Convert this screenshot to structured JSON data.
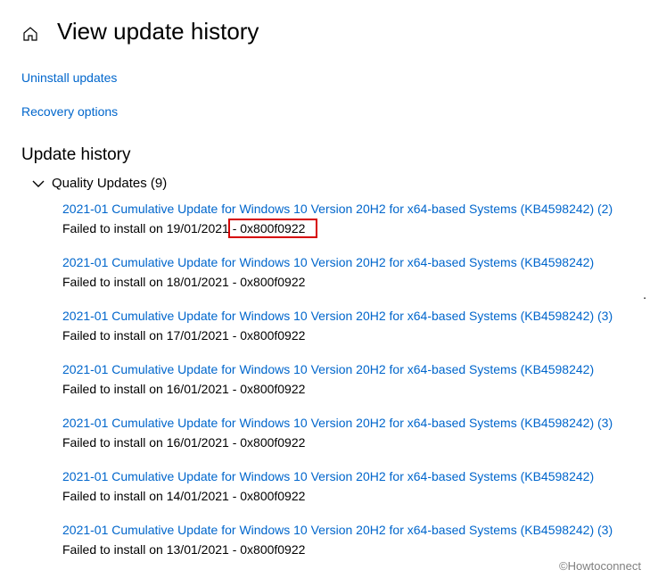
{
  "page_title": "View update history",
  "links": {
    "uninstall": "Uninstall updates",
    "recovery": "Recovery options"
  },
  "section_heading": "Update history",
  "group": {
    "label": "Quality Updates (9)"
  },
  "updates": [
    {
      "title": "2021-01 Cumulative Update for Windows 10 Version 20H2 for x64-based Systems (KB4598242) (2)",
      "status": "Failed to install on 19/01/2021 - 0x800f0922",
      "highlighted": true
    },
    {
      "title": "2021-01 Cumulative Update for Windows 10 Version 20H2 for x64-based Systems (KB4598242)",
      "status": "Failed to install on 18/01/2021 - 0x800f0922"
    },
    {
      "title": "2021-01 Cumulative Update for Windows 10 Version 20H2 for x64-based Systems (KB4598242) (3)",
      "status": "Failed to install on 17/01/2021 - 0x800f0922"
    },
    {
      "title": "2021-01 Cumulative Update for Windows 10 Version 20H2 for x64-based Systems (KB4598242)",
      "status": "Failed to install on 16/01/2021 - 0x800f0922"
    },
    {
      "title": "2021-01 Cumulative Update for Windows 10 Version 20H2 for x64-based Systems (KB4598242) (3)",
      "status": "Failed to install on 16/01/2021 - 0x800f0922"
    },
    {
      "title": "2021-01 Cumulative Update for Windows 10 Version 20H2 for x64-based Systems (KB4598242)",
      "status": "Failed to install on 14/01/2021 - 0x800f0922"
    },
    {
      "title": "2021-01 Cumulative Update for Windows 10 Version 20H2 for x64-based Systems (KB4598242) (3)",
      "status": "Failed to install on 13/01/2021 - 0x800f0922"
    }
  ],
  "watermark": "©Howtoconnect"
}
